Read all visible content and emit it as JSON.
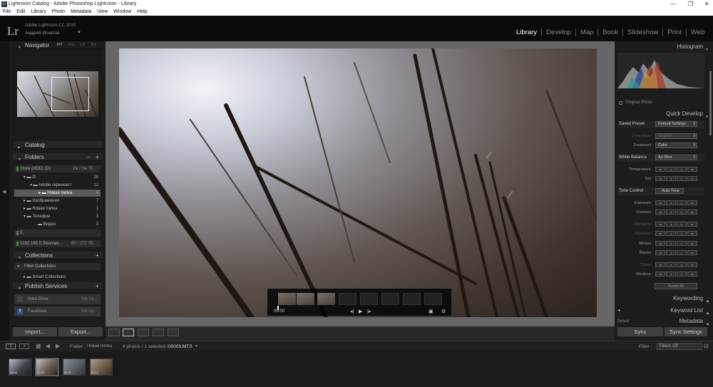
{
  "window": {
    "title": "Lightroom Catalog - Adobe Photoshop Lightroom - Library",
    "icon": "Lr",
    "controls": [
      "—",
      "❐",
      "✕"
    ]
  },
  "menu": [
    "File",
    "Edit",
    "Library",
    "Photo",
    "Metadata",
    "View",
    "Window",
    "Help"
  ],
  "identity": {
    "logo": "Lr",
    "product": "Adobe Lightroom CC 2015",
    "user": "Андрей Игнатов",
    "caret": "▼"
  },
  "modules": [
    {
      "label": "Library",
      "active": true
    },
    {
      "label": "Develop"
    },
    {
      "label": "Map"
    },
    {
      "label": "Book"
    },
    {
      "label": "Slideshow"
    },
    {
      "label": "Print"
    },
    {
      "label": "Web"
    }
  ],
  "navigator": {
    "title": "Navigator",
    "zoom": [
      "FIT",
      "FILL",
      "1:1",
      "3:1"
    ]
  },
  "catalog": {
    "title": "Catalog"
  },
  "folders": {
    "title": "Folders",
    "add": "+",
    "volume1": {
      "name": "Store (HDD) (D)",
      "space": "2ж / 3ж ТБ"
    },
    "rows": [
      {
        "label": "D:",
        "count": "26"
      },
      {
        "label": "Adobe скринкаст",
        "count": "12"
      },
      {
        "label": "Новая папка",
        "count": "4",
        "selected": true
      },
      {
        "label": "Изображения",
        "count": "7"
      },
      {
        "label": "Новая папка",
        "count": "1"
      },
      {
        "label": "Телефон",
        "count": "3"
      },
      {
        "label": "Видео",
        "count": "3"
      }
    ],
    "volume2_label": "E:",
    "volume3": {
      "name": "\\\\192.168.0.3\\koman...",
      "space": "80 / 272 ТБ"
    }
  },
  "collections": {
    "title": "Collections",
    "add": "+",
    "filter": "Filter Collections",
    "smart": "Smart Collections"
  },
  "publish": {
    "title": "Publish Services",
    "add": "+",
    "services": [
      {
        "name": "Hard Drive",
        "setup": "Set Up..."
      },
      {
        "name": "Facebook",
        "setup": "Set Up..."
      }
    ]
  },
  "buttons": {
    "import": "Import...",
    "export": "Export...",
    "sync": "Sync",
    "sync_settings": "Sync Settings"
  },
  "video": {
    "time": "00:00"
  },
  "right": {
    "histogram": "Histogram",
    "original_photo": "Original Photo",
    "quick_develop": "Quick Develop",
    "saved_preset": {
      "label": "Saved Preset",
      "value": "Default Settings"
    },
    "crop_ratio": {
      "label": "Crop Ratio",
      "value": "Original"
    },
    "treatment": {
      "label": "Treatment",
      "value": "Color"
    },
    "white_balance": {
      "label": "White Balance",
      "value": "As Shot"
    },
    "wb_rows": [
      "Temperature",
      "Tint"
    ],
    "tone_control": {
      "label": "Tone Control",
      "value": "Auto Tone"
    },
    "tone_rows": [
      "Exposure",
      "Contrast",
      "Highlights",
      "Shadows",
      "Whites",
      "Blacks",
      "Clarity",
      "Vibrance"
    ],
    "reset_all": "Reset All",
    "keywording": "Keywording",
    "keyword_list": "Keyword List",
    "metadata": "Metadata",
    "metadata_preset": "Default"
  },
  "filmhead": {
    "pages": [
      "1",
      "2"
    ],
    "source": "Folder :",
    "folder": "Новая папка",
    "count": "4 photos / 1 selected /",
    "file": "00003.MTS",
    "caret": "▼",
    "filter_label": "Filter :",
    "filter_value": "Filters Off"
  },
  "filmstrip": {
    "thumbs": [
      {
        "dur": "00:06"
      },
      {
        "dur": "00:03",
        "selected": true
      },
      {
        "dur": "00:30"
      },
      {
        "dur": "00:16"
      }
    ]
  },
  "colors": {
    "accent": "#ffffff",
    "panel": "#1c1c1c",
    "background": "#0d0d0d",
    "center": "#666666"
  }
}
